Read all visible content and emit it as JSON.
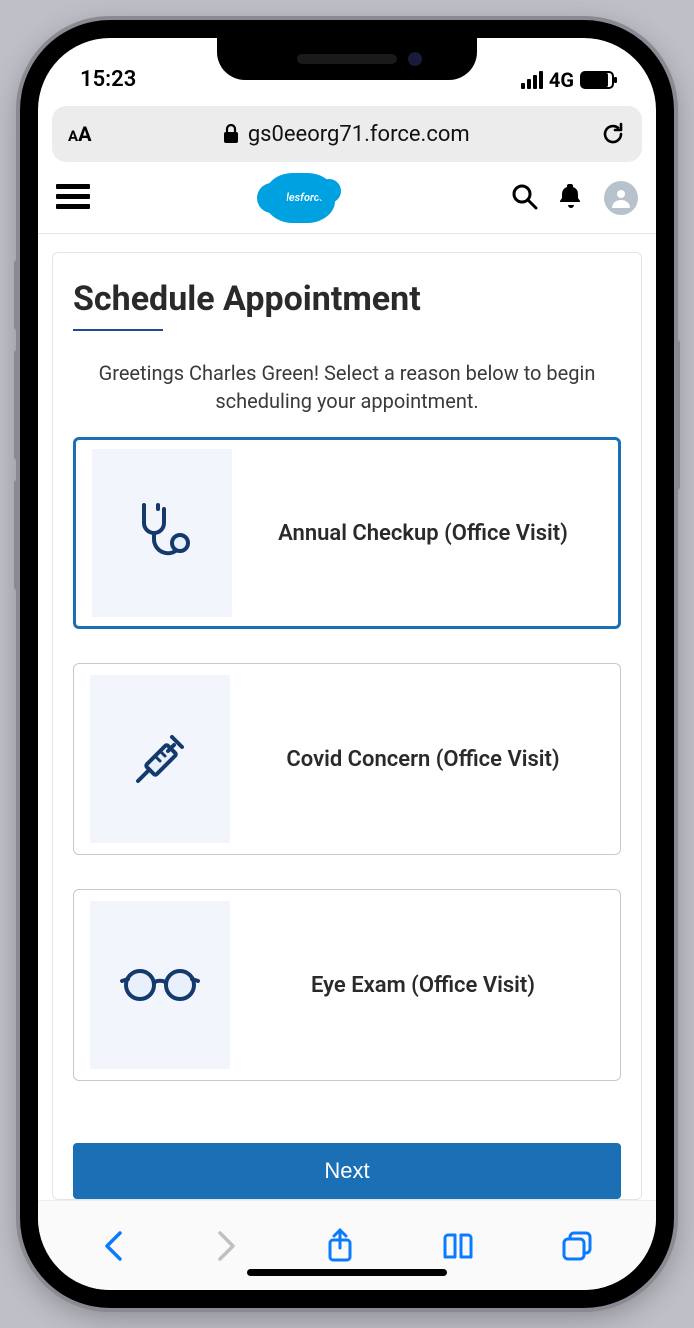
{
  "status": {
    "time": "15:23",
    "network": "4G"
  },
  "browser": {
    "domain": "gs0eeorg71.force.com"
  },
  "header": {
    "logo_text": "salesforce"
  },
  "main": {
    "title": "Schedule Appointment",
    "greeting": "Greetings Charles Green! Select a reason below to begin scheduling your appointment.",
    "options": [
      {
        "label": "Annual Checkup (Office Visit)",
        "icon": "stethoscope-icon",
        "selected": true
      },
      {
        "label": "Covid Concern (Office Visit)",
        "icon": "syringe-icon",
        "selected": false
      },
      {
        "label": "Eye Exam (Office Visit)",
        "icon": "glasses-icon",
        "selected": false
      }
    ],
    "next_label": "Next"
  },
  "colors": {
    "brand_blue": "#1b6fb5",
    "logo_blue": "#00a1e0",
    "icon_stroke": "#143a6c",
    "icon_fill": "#e8f0fb",
    "safari_icon": "#0a7aff"
  }
}
